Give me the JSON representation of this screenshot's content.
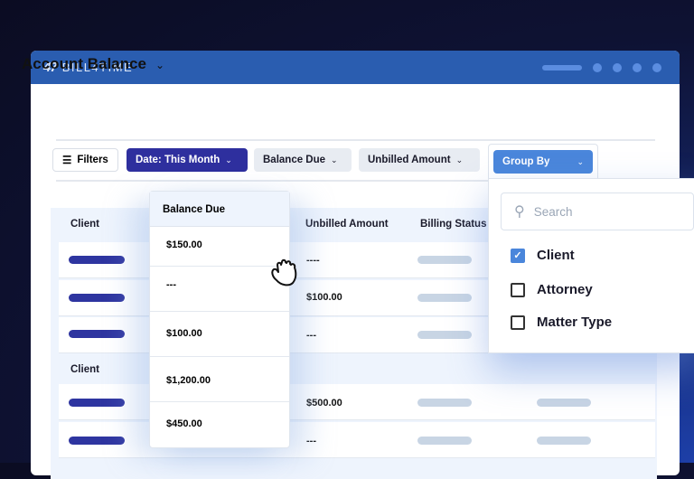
{
  "app": {
    "brand": "BILL4TIME",
    "logo_mark": "47"
  },
  "page": {
    "title": "Account Balance"
  },
  "toolbar": {
    "filters": "Filters",
    "date": "Date: This Month",
    "balance_due": "Balance Due",
    "unbilled": "Unbilled Amount",
    "group_by": "Group By"
  },
  "table": {
    "headers": {
      "client": "Client",
      "balance_due": "Balance Due",
      "unbilled": "Unbilled Amount",
      "billing_status": "Billing Status"
    },
    "group_label": "Client",
    "unbilled_values": [
      "----",
      "$100.00",
      "---",
      "$500.00",
      "---"
    ],
    "balance_values": [
      "$150.00",
      "---",
      "$100.00",
      "$1,200.00",
      "$450.00"
    ]
  },
  "group_by_menu": {
    "search_placeholder": "Search",
    "options": [
      {
        "label": "Client",
        "checked": true
      },
      {
        "label": "Attorney",
        "checked": false
      },
      {
        "label": "Matter Type",
        "checked": false
      }
    ]
  },
  "colors": {
    "header": "#2a5db0",
    "primary": "#2e2f9e",
    "accent": "#4a86db"
  }
}
